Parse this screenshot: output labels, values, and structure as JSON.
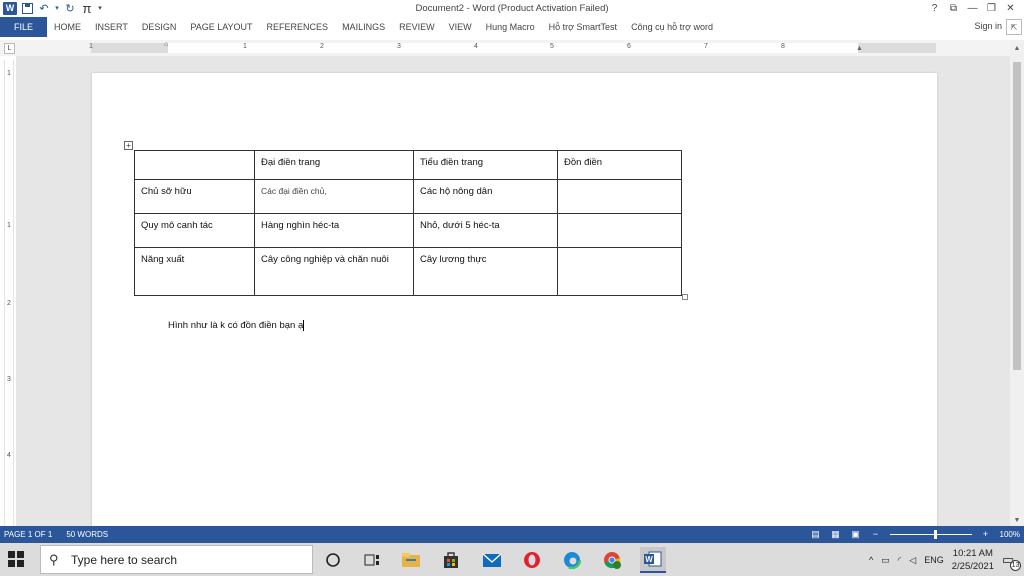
{
  "window": {
    "title": "Document2 - Word (Product Activation Failed)",
    "controls": [
      "?",
      "⧉",
      "—",
      "❐",
      "✕"
    ]
  },
  "quick_access": [
    "word-logo",
    "save-icon",
    "undo-icon",
    "redo-icon",
    "pi-equation-icon",
    "customize-icon"
  ],
  "ribbon": {
    "file_label": "FILE",
    "tabs": [
      "HOME",
      "INSERT",
      "DESIGN",
      "PAGE LAYOUT",
      "REFERENCES",
      "MAILINGS",
      "REVIEW",
      "VIEW",
      "Hung Macro",
      "Hỗ trợ SmartTest",
      "Công cụ hỗ trợ word"
    ],
    "sign_in": "Sign in"
  },
  "ruler": {
    "tab_selector": "L",
    "numbers": [
      "1",
      "1",
      "2",
      "3",
      "4",
      "5",
      "6",
      "7",
      "8"
    ],
    "vertical_numbers": [
      "1",
      "1",
      "2",
      "3",
      "4"
    ]
  },
  "table": {
    "rows": [
      [
        "",
        "Đại điền trang",
        "Tiểu điền trang",
        "Đồn điền"
      ],
      [
        "Chủ sỡ hữu",
        "Các đại điền chủ,",
        "Các hộ nông dân",
        ""
      ],
      [
        "Quy mô canh tác",
        "Hàng nghìn héc-ta",
        "Nhỏ, dưới 5 héc-ta",
        ""
      ],
      [
        "Năng xuất",
        "Cây công nghiệp và chăn nuôi",
        "Cây lương thực",
        ""
      ]
    ],
    "move_handle": "+"
  },
  "paragraph": "Hình như là k có đồn điền bạn ạ",
  "status": {
    "page": "PAGE 1 OF 1",
    "words": "50 WORDS",
    "zoom": "100%",
    "zoom_level": 1.0
  },
  "taskbar": {
    "search_placeholder": "Type here to search",
    "apps": [
      "cortana-icon",
      "task-view-icon",
      "file-explorer-icon",
      "store-icon",
      "mail-icon",
      "opera-icon",
      "edge-icon",
      "chrome-icon",
      "word-icon"
    ],
    "language": "ENG",
    "time": "10:21 AM",
    "date": "2/25/2021",
    "notification_count": "13"
  },
  "colors": {
    "accent": "#2b579a",
    "workspace": "#e6e6e6",
    "taskbar": "#dcdcdc"
  }
}
